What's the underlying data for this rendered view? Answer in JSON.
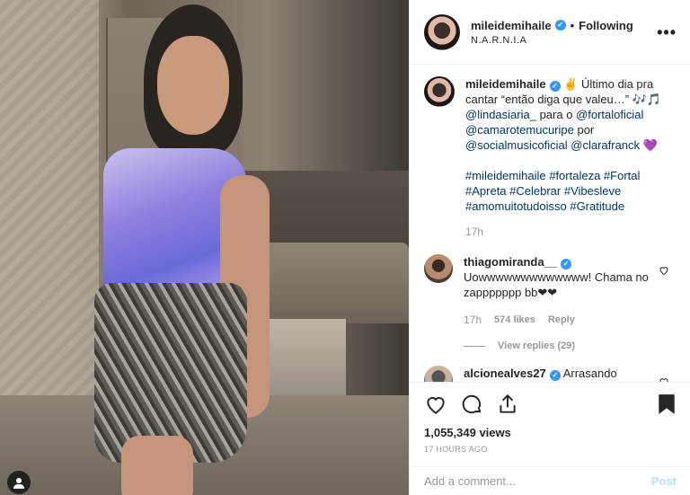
{
  "post": {
    "username": "mileidemihaile",
    "verified_mark": "✓",
    "separator": "•",
    "follow_status": "Following",
    "location": "N.A.R.N.I.A",
    "more_glyph": "•••"
  },
  "caption": {
    "username": "mileidemihaile",
    "text_start": " ✌️ Último dia pra cantar “então diga que valeu…” 🎶🎵 ",
    "mention1": "@lindasiaria_",
    "text_mid1": " para o ",
    "mention2": "@fortaloficial",
    "mention3": "@camarotemucuripe",
    "text_mid2": " por ",
    "mention4": "@socialmusicoficial",
    "mention5": "@clarafranck",
    "text_end": " 💜",
    "hashtags_line1": "#mileidemihaile #fortaleza #Fortal",
    "hashtags_line2": "#Apreta #Celebrar #Vibesleve",
    "hashtags_line3": "#amomuitotudoisso #Gratitude",
    "age": "17h"
  },
  "comments": [
    {
      "username": "thiagomiranda__",
      "text": " Uowwwwwwwwwwwww! Chama no zappppppp bb❤❤",
      "age": "17h",
      "likes": "574 likes",
      "reply_label": "Reply",
      "view_replies": "View replies (29)"
    },
    {
      "username": "alcionealves27",
      "text": " Arrasando"
    }
  ],
  "actions": {
    "views": "1,055,349 views",
    "timestamp": "17 HOURS AGO"
  },
  "composer": {
    "placeholder": "Add a comment...",
    "post_label": "Post"
  },
  "colors": {
    "accent_link": "#003569",
    "verified": "#3897f0",
    "post_disabled": "#b2dffc",
    "muted": "#999999"
  },
  "icons": {
    "like": "heart-icon",
    "comment": "comment-icon",
    "share": "share-icon",
    "save": "bookmark-icon",
    "more": "more-options-icon"
  }
}
